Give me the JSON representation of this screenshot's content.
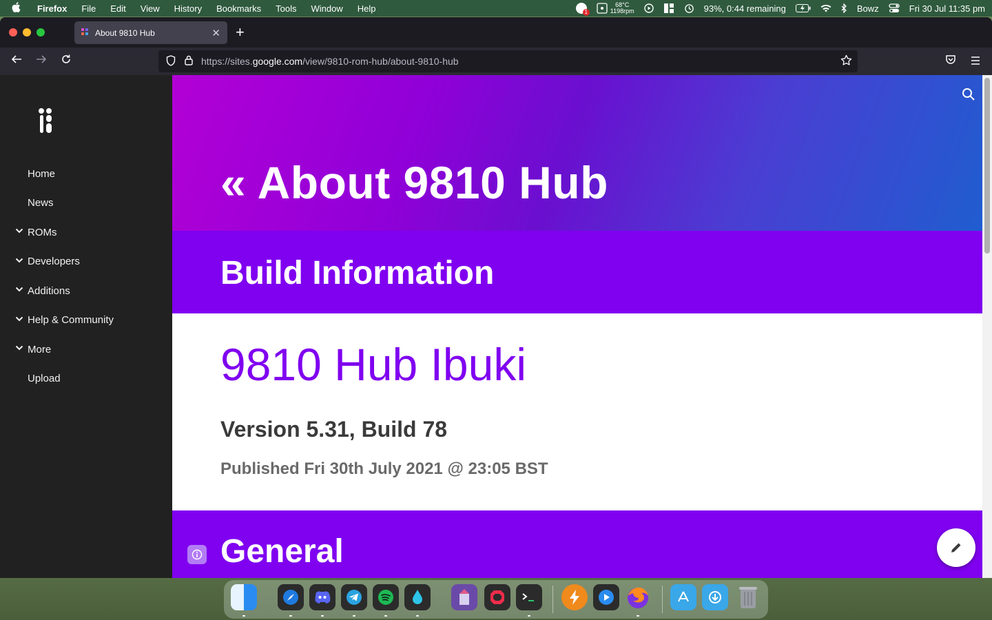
{
  "menubar": {
    "apple_icon": "apple-icon",
    "app_name": "Firefox",
    "items": [
      "File",
      "Edit",
      "View",
      "History",
      "Bookmarks",
      "Tools",
      "Window",
      "Help"
    ],
    "notification_count": "1",
    "temp": "68°C",
    "fan": "1198rpm",
    "battery": "93%, 0:44 remaining",
    "user": "Bowz",
    "datetime": "Fri 30 Jul  11:35 pm"
  },
  "browser": {
    "tab_title": "About 9810 Hub",
    "new_tab_label": "+",
    "url_prefix": "https://sites.",
    "url_domain": "google.com",
    "url_path": "/view/9810-rom-hub/about-9810-hub"
  },
  "sidebar": {
    "items": [
      {
        "label": "Home",
        "expandable": false
      },
      {
        "label": "News",
        "expandable": false
      },
      {
        "label": "ROMs",
        "expandable": true
      },
      {
        "label": "Developers",
        "expandable": true
      },
      {
        "label": "Additions",
        "expandable": true
      },
      {
        "label": "Help & Community",
        "expandable": true
      },
      {
        "label": "More",
        "expandable": true
      },
      {
        "label": "Upload",
        "expandable": false
      }
    ]
  },
  "main": {
    "hero_title": "« About 9810 Hub",
    "build_heading": "Build Information",
    "build_name": "9810 Hub Ibuki",
    "version": "Version 5.31, Build 78",
    "published": "Published Fri 30th July 2021 @ 23:05 BST",
    "general_heading": "General"
  },
  "colors": {
    "accent_purple": "#8000f0",
    "sidebar_bg": "#212121",
    "toolbar_bg": "#2b2a33"
  },
  "dock": {
    "apps": [
      "finder",
      "safari",
      "discord",
      "telegram",
      "spotify",
      "drop",
      "castle",
      "opera",
      "terminal",
      "reeder",
      "vlc",
      "firefox",
      "applications",
      "downloads",
      "trash"
    ]
  }
}
